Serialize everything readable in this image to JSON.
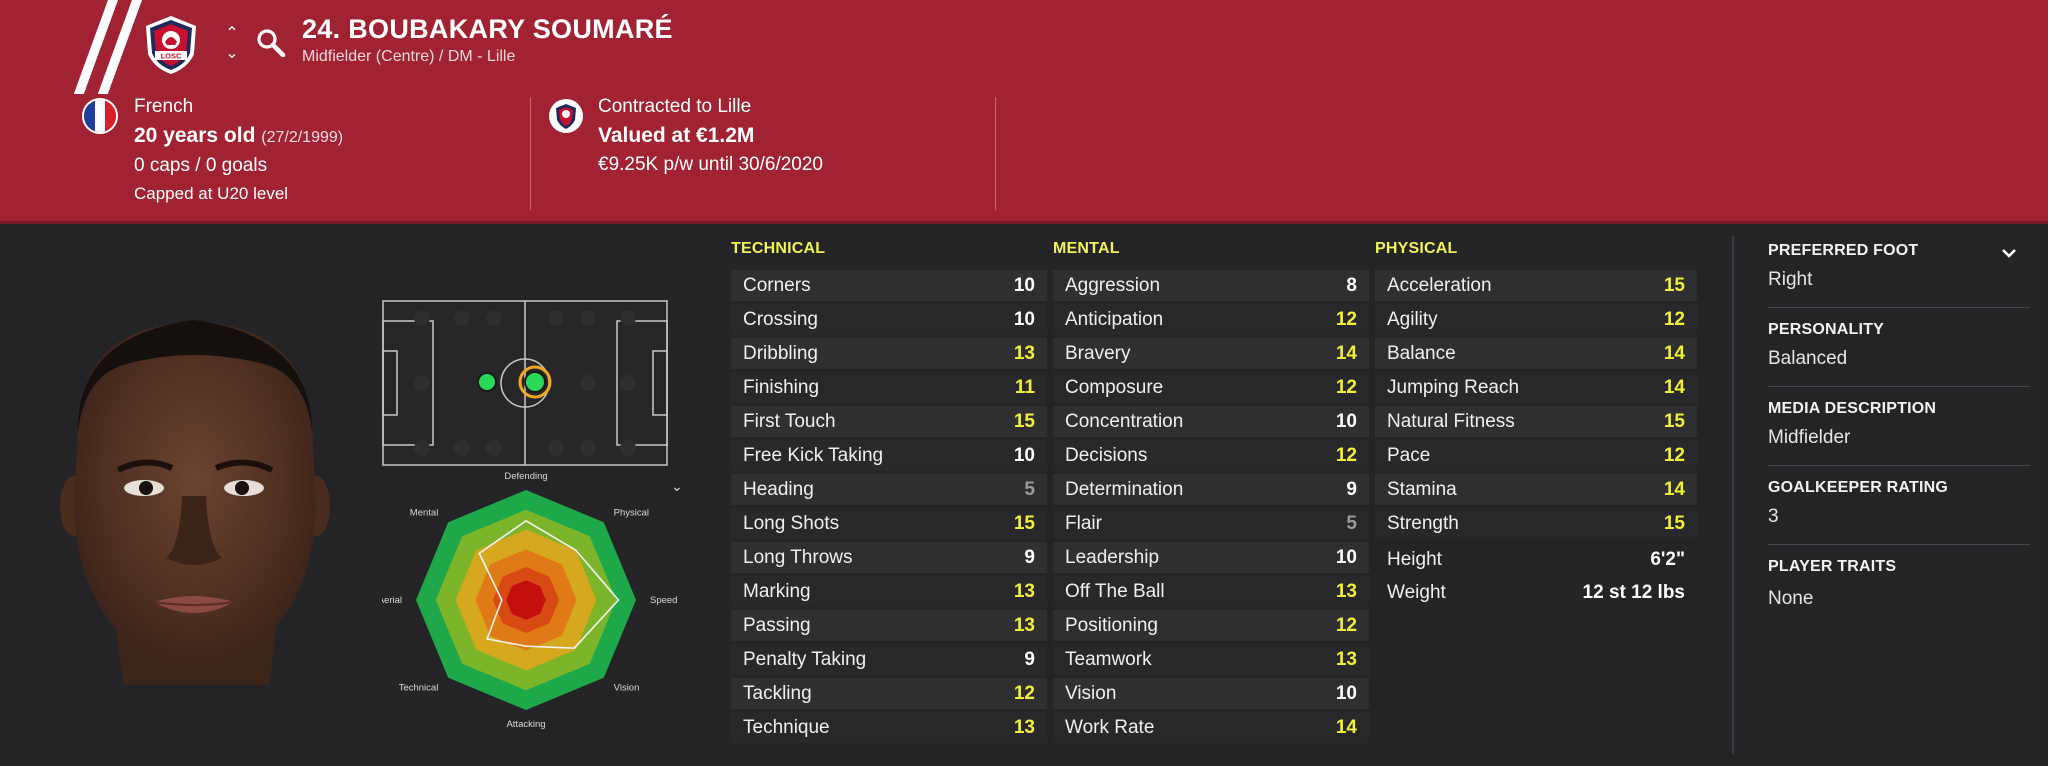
{
  "header": {
    "player_number_name": "24. BOUBAKARY SOUMARÉ",
    "role": "Midfielder (Centre) / DM - Lille",
    "club_crest_text": "LOSC",
    "nationality": "French",
    "age": "20 years old",
    "dob": "(27/2/1999)",
    "caps": "0 caps / 0 goals",
    "capped_level": "Capped at U20 level",
    "contract": "Contracted to Lille",
    "value": "Valued at €1.2M",
    "wage": "€9.25K p/w until 30/6/2020"
  },
  "colors": {
    "header_bg": "#a12233",
    "attr_yellow": "#f3f03a",
    "attr_white": "#ffffff",
    "attr_gray": "#9a9a9a"
  },
  "radar": {
    "labels": [
      "Defending",
      "Physical",
      "Speed",
      "Vision",
      "Attacking",
      "Technical",
      "Aerial",
      "Mental"
    ],
    "values": [
      0.72,
      0.64,
      0.84,
      0.62,
      0.42,
      0.5,
      0.22,
      0.6
    ]
  },
  "technical": {
    "heading": "TECHNICAL",
    "rows": [
      {
        "name": "Corners",
        "value": "10",
        "tone": "white"
      },
      {
        "name": "Crossing",
        "value": "10",
        "tone": "white"
      },
      {
        "name": "Dribbling",
        "value": "13",
        "tone": "yellow"
      },
      {
        "name": "Finishing",
        "value": "11",
        "tone": "yellow"
      },
      {
        "name": "First Touch",
        "value": "15",
        "tone": "yellow"
      },
      {
        "name": "Free Kick Taking",
        "value": "10",
        "tone": "white"
      },
      {
        "name": "Heading",
        "value": "5",
        "tone": "gray"
      },
      {
        "name": "Long Shots",
        "value": "15",
        "tone": "yellow"
      },
      {
        "name": "Long Throws",
        "value": "9",
        "tone": "white"
      },
      {
        "name": "Marking",
        "value": "13",
        "tone": "yellow"
      },
      {
        "name": "Passing",
        "value": "13",
        "tone": "yellow"
      },
      {
        "name": "Penalty Taking",
        "value": "9",
        "tone": "white"
      },
      {
        "name": "Tackling",
        "value": "12",
        "tone": "yellow"
      },
      {
        "name": "Technique",
        "value": "13",
        "tone": "yellow"
      }
    ]
  },
  "mental": {
    "heading": "MENTAL",
    "rows": [
      {
        "name": "Aggression",
        "value": "8",
        "tone": "white"
      },
      {
        "name": "Anticipation",
        "value": "12",
        "tone": "yellow"
      },
      {
        "name": "Bravery",
        "value": "14",
        "tone": "yellow"
      },
      {
        "name": "Composure",
        "value": "12",
        "tone": "yellow"
      },
      {
        "name": "Concentration",
        "value": "10",
        "tone": "white"
      },
      {
        "name": "Decisions",
        "value": "12",
        "tone": "yellow"
      },
      {
        "name": "Determination",
        "value": "9",
        "tone": "white"
      },
      {
        "name": "Flair",
        "value": "5",
        "tone": "gray"
      },
      {
        "name": "Leadership",
        "value": "10",
        "tone": "white"
      },
      {
        "name": "Off The Ball",
        "value": "13",
        "tone": "yellow"
      },
      {
        "name": "Positioning",
        "value": "12",
        "tone": "yellow"
      },
      {
        "name": "Teamwork",
        "value": "13",
        "tone": "yellow"
      },
      {
        "name": "Vision",
        "value": "10",
        "tone": "white"
      },
      {
        "name": "Work Rate",
        "value": "14",
        "tone": "yellow"
      }
    ]
  },
  "physical": {
    "heading": "PHYSICAL",
    "rows": [
      {
        "name": "Acceleration",
        "value": "15",
        "tone": "yellow"
      },
      {
        "name": "Agility",
        "value": "12",
        "tone": "yellow"
      },
      {
        "name": "Balance",
        "value": "14",
        "tone": "yellow"
      },
      {
        "name": "Jumping Reach",
        "value": "14",
        "tone": "yellow"
      },
      {
        "name": "Natural Fitness",
        "value": "15",
        "tone": "yellow"
      },
      {
        "name": "Pace",
        "value": "12",
        "tone": "yellow"
      },
      {
        "name": "Stamina",
        "value": "14",
        "tone": "yellow"
      },
      {
        "name": "Strength",
        "value": "15",
        "tone": "yellow"
      }
    ],
    "height_label": "Height",
    "height_value": "6'2\"",
    "weight_label": "Weight",
    "weight_value": "12 st 12 lbs"
  },
  "side_panel": {
    "preferred_foot_title": "PREFERRED FOOT",
    "preferred_foot_value": "Right",
    "personality_title": "PERSONALITY",
    "personality_value": "Balanced",
    "media_title": "MEDIA DESCRIPTION",
    "media_value": "Midfielder",
    "gk_title": "GOALKEEPER RATING",
    "gk_value": "3",
    "traits_title": "PLAYER TRAITS",
    "traits_value": "None"
  }
}
